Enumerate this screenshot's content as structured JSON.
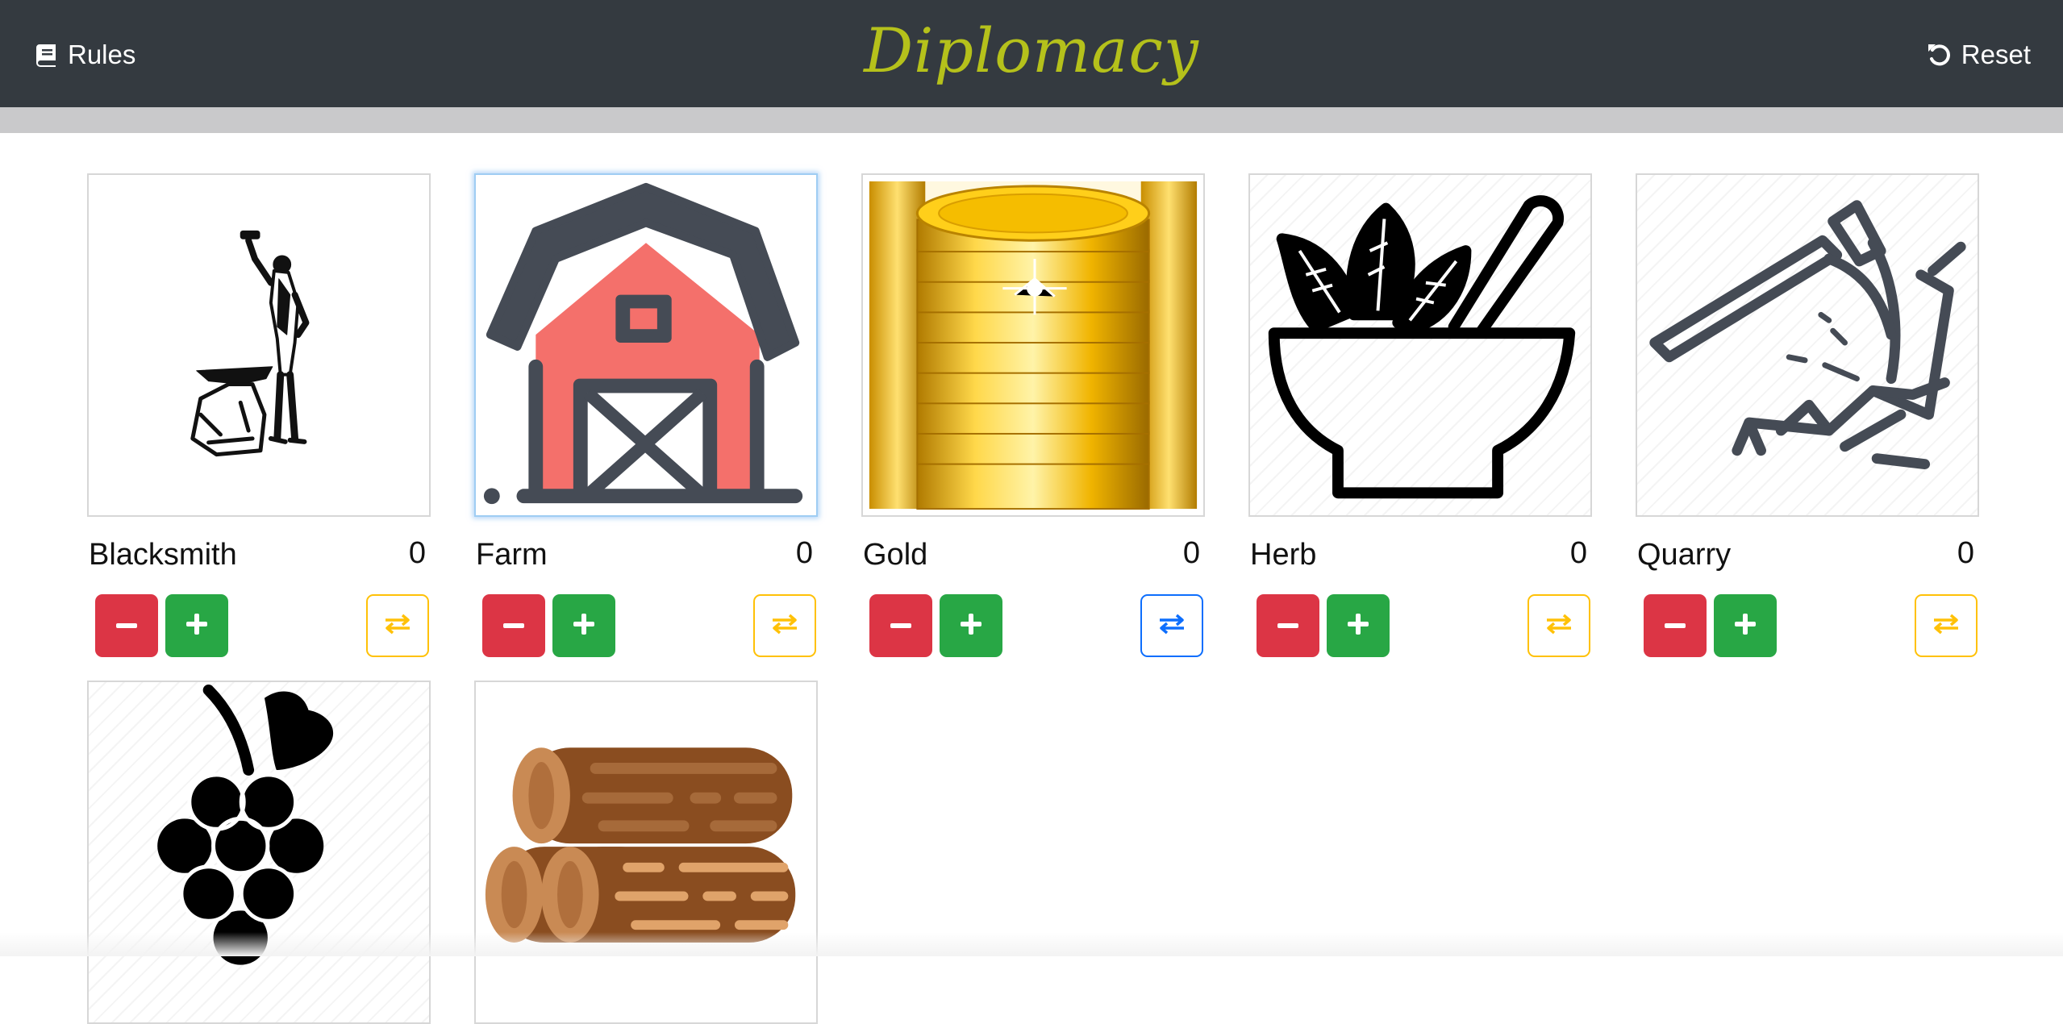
{
  "navbar": {
    "rules_label": "Rules",
    "brand": "Diplomacy",
    "reset_label": "Reset"
  },
  "resources": [
    {
      "name": "Blacksmith",
      "count": "0",
      "icon": "blacksmith-icon"
    },
    {
      "name": "Farm",
      "count": "0",
      "icon": "barn-icon"
    },
    {
      "name": "Gold",
      "count": "0",
      "icon": "gold-coins-icon"
    },
    {
      "name": "Herb",
      "count": "0",
      "icon": "mortar-pestle-icon"
    },
    {
      "name": "Quarry",
      "count": "0",
      "icon": "pickaxe-icon"
    },
    {
      "name": "",
      "count": "",
      "icon": "grapes-icon"
    },
    {
      "name": "",
      "count": "",
      "icon": "logs-icon"
    }
  ],
  "colors": {
    "navbar": "#343a40",
    "brand": "#b5c11b",
    "minus": "#dc3545",
    "plus": "#28a745",
    "trade_border": "#ffc107",
    "trade_active": "#0d6efd"
  }
}
